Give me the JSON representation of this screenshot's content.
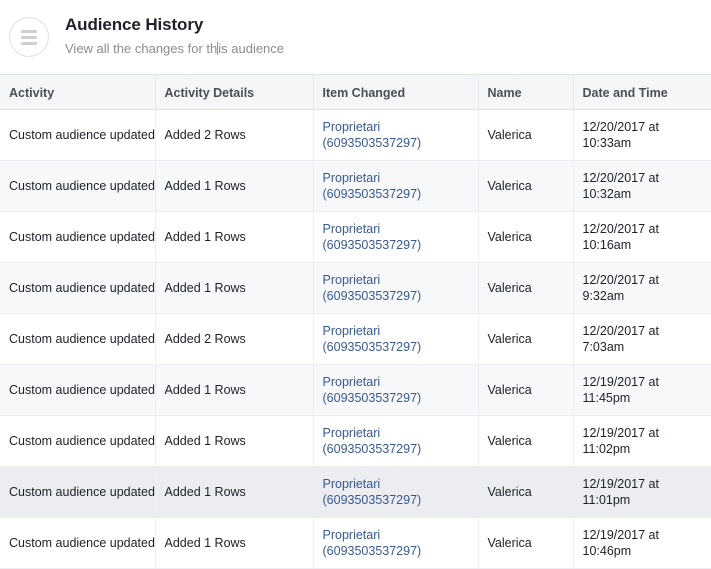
{
  "header": {
    "menu_icon": "hamburger-menu-icon",
    "title": "Audience History",
    "subtitle_before_caret": "View all the changes for th",
    "subtitle_after_caret": "is audience",
    "subtitle_full": "View all the changes for this audience"
  },
  "table": {
    "columns": [
      {
        "key": "activity",
        "label": "Activity"
      },
      {
        "key": "details",
        "label": "Activity Details"
      },
      {
        "key": "item",
        "label": "Item Changed"
      },
      {
        "key": "name",
        "label": "Name"
      },
      {
        "key": "date",
        "label": "Date and Time"
      }
    ],
    "rows": [
      {
        "activity": "Custom audience updated",
        "details": "Added 2 Rows",
        "item_name": "Proprietari",
        "item_id": "(6093503537297)",
        "name": "Valerica",
        "date": "12/20/2017 at 10:33am",
        "hover": false
      },
      {
        "activity": "Custom audience updated",
        "details": "Added 1 Rows",
        "item_name": "Proprietari",
        "item_id": "(6093503537297)",
        "name": "Valerica",
        "date": "12/20/2017 at 10:32am",
        "hover": false
      },
      {
        "activity": "Custom audience updated",
        "details": "Added 1 Rows",
        "item_name": "Proprietari",
        "item_id": "(6093503537297)",
        "name": "Valerica",
        "date": "12/20/2017 at 10:16am",
        "hover": false
      },
      {
        "activity": "Custom audience updated",
        "details": "Added 1 Rows",
        "item_name": "Proprietari",
        "item_id": "(6093503537297)",
        "name": "Valerica",
        "date": "12/20/2017 at 9:32am",
        "hover": false
      },
      {
        "activity": "Custom audience updated",
        "details": "Added 2 Rows",
        "item_name": "Proprietari",
        "item_id": "(6093503537297)",
        "name": "Valerica",
        "date": "12/20/2017 at 7:03am",
        "hover": false
      },
      {
        "activity": "Custom audience updated",
        "details": "Added 1 Rows",
        "item_name": "Proprietari",
        "item_id": "(6093503537297)",
        "name": "Valerica",
        "date": "12/19/2017 at 11:45pm",
        "hover": false
      },
      {
        "activity": "Custom audience updated",
        "details": "Added 1 Rows",
        "item_name": "Proprietari",
        "item_id": "(6093503537297)",
        "name": "Valerica",
        "date": "12/19/2017 at 11:02pm",
        "hover": false
      },
      {
        "activity": "Custom audience updated",
        "details": "Added 1 Rows",
        "item_name": "Proprietari",
        "item_id": "(6093503537297)",
        "name": "Valerica",
        "date": "12/19/2017 at 11:01pm",
        "hover": true
      },
      {
        "activity": "Custom audience updated",
        "details": "Added 1 Rows",
        "item_name": "Proprietari",
        "item_id": "(6093503537297)",
        "name": "Valerica",
        "date": "12/19/2017 at 10:46pm",
        "hover": false
      }
    ]
  },
  "colors": {
    "link": "#385898",
    "text": "#1d2129",
    "muted": "#9197a3",
    "header_bg": "#f5f6f7",
    "row_alt_bg": "#f7f8f9",
    "row_hover_bg": "#ebedf0"
  }
}
